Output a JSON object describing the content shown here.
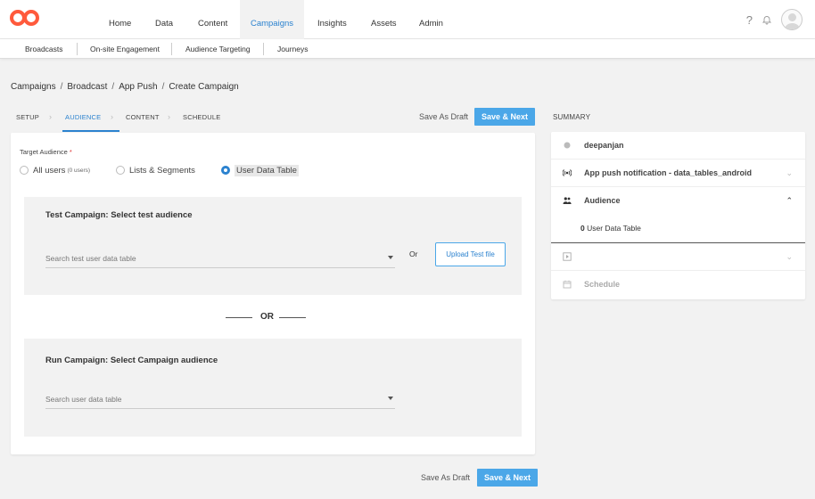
{
  "app": {
    "logo": "logo-icon",
    "brand_color": "#ff5a3c",
    "accent_color": "#2b82cf"
  },
  "nav": {
    "items": [
      "Home",
      "Data",
      "Content",
      "Campaigns",
      "Insights",
      "Assets",
      "Admin"
    ],
    "active": "Campaigns",
    "help_label": "?"
  },
  "subnav": {
    "items": [
      "Broadcasts",
      "On-site Engagement",
      "Audience Targeting",
      "Journeys"
    ]
  },
  "breadcrumb": [
    "Campaigns",
    "Broadcast",
    "App Push",
    "Create Campaign"
  ],
  "breadcrumb_separator": "/",
  "steps": [
    "SETUP",
    "AUDIENCE",
    "CONTENT",
    "SCHEDULE"
  ],
  "active_step": "AUDIENCE",
  "actions": {
    "save_draft": "Save As Draft",
    "save_next": "Save & Next"
  },
  "target_audience": {
    "label": "Target Audience",
    "required_mark": "*",
    "options": [
      {
        "label": "All users",
        "note": "(0 users)",
        "selected": false
      },
      {
        "label": "Lists & Segments",
        "note": "",
        "selected": false
      },
      {
        "label": "User Data Table",
        "note": "",
        "selected": true
      }
    ]
  },
  "test_campaign": {
    "title": "Test Campaign: Select test audience",
    "search_placeholder": "Search test user data table",
    "or_label": "Or",
    "upload_label": "Upload Test file"
  },
  "divider_label": "OR",
  "run_campaign": {
    "title": "Run Campaign: Select Campaign audience",
    "search_placeholder": "Search user data table"
  },
  "summary": {
    "title": "SUMMARY",
    "rows": [
      {
        "icon": "dot-icon",
        "label": "deepanjan"
      },
      {
        "icon": "broadcast-icon",
        "label": "App push notification - data_tables_android"
      },
      {
        "icon": "users-icon",
        "label": "Audience"
      },
      {
        "icon": "play-icon",
        "label": ""
      },
      {
        "icon": "calendar-icon",
        "label": "Schedule"
      }
    ],
    "audience_count": "0",
    "audience_text": "User Data Table"
  }
}
